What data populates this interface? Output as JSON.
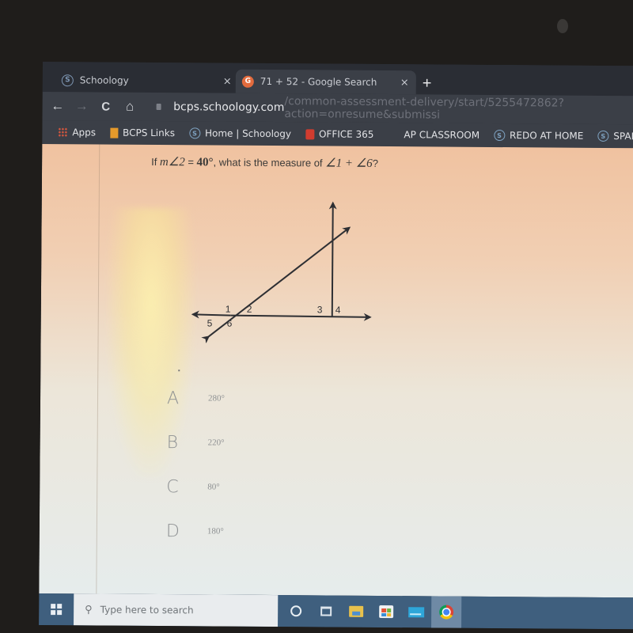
{
  "browser": {
    "tabs": [
      {
        "icon": "schoology-icon",
        "favicon_text": "S",
        "title": "Schoology",
        "active": false
      },
      {
        "icon": "google-icon",
        "favicon_text": "G",
        "title": "71 + 52 - Google Search",
        "active": true
      }
    ],
    "close_glyph": "×",
    "new_tab_glyph": "+",
    "nav": {
      "back": "←",
      "forward": "→",
      "reload": "C",
      "home": "⌂"
    },
    "url": {
      "host": "bcps.schoology.com",
      "path": "/common-assessment-delivery/start/5255472862?action=onresume&submissi"
    },
    "bookmarks": [
      {
        "icon": "apps-grid-icon",
        "label": "Apps"
      },
      {
        "icon": "bcps-bookmark-icon",
        "label": "BCPS Links"
      },
      {
        "icon": "schoology-icon",
        "label": "Home | Schoology"
      },
      {
        "icon": "office-icon",
        "label": "OFFICE 365"
      },
      {
        "icon": "",
        "label": "AP CLASSROOM"
      },
      {
        "icon": "schoology-icon",
        "label": "REDO AT HOME"
      },
      {
        "icon": "schoology-icon",
        "label": "SPANISH JUST WA"
      }
    ]
  },
  "question": {
    "prefix": "If ",
    "angle_expr": "m∠2",
    "equals": " = ",
    "given_value": "40°",
    "middle": ", what is the measure of ",
    "target_expr": "∠1 + ∠6",
    "suffix": "?"
  },
  "diagram": {
    "labels": [
      "1",
      "2",
      "3",
      "4",
      "5",
      "6"
    ],
    "lines": [
      "horizontal line",
      "transversal",
      "vertical ray"
    ]
  },
  "choices": [
    {
      "letter": "A",
      "value": "280°"
    },
    {
      "letter": "B",
      "value": "220°"
    },
    {
      "letter": "C",
      "value": "80°"
    },
    {
      "letter": "D",
      "value": "180°"
    }
  ],
  "taskbar": {
    "search_placeholder": "Type here to search",
    "apps": [
      "cortana-icon",
      "task-view-icon",
      "file-explorer-icon",
      "store-icon",
      "mail-icon",
      "chrome-icon"
    ]
  }
}
